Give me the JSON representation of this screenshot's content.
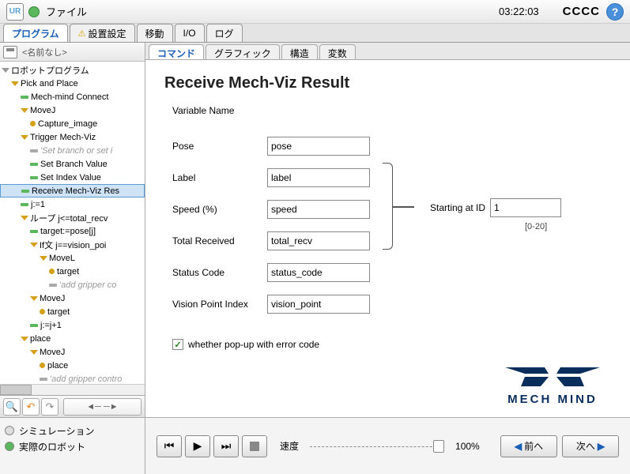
{
  "titlebar": {
    "file": "ファイル",
    "time": "03:22:03",
    "cccc": "CCCC"
  },
  "main_tabs": [
    "プログラム",
    "設置設定",
    "移動",
    "I/O",
    "ログ"
  ],
  "filebar": {
    "name": "<名前なし>"
  },
  "tree": {
    "root": "ロボットプログラム",
    "items": [
      "Pick and Place",
      "Mech-mind Connect",
      "MoveJ",
      "Capture_image",
      "Trigger Mech-Viz",
      "'Set branch or set i",
      "Set Branch Value",
      "Set Index Value",
      "Receive Mech-Viz Res",
      "j:=1",
      "ループ j<=total_recv",
      "target:=pose[j]",
      "If文 j==vision_poi",
      "MoveL",
      "target",
      "'add gripper co",
      "MoveJ",
      "target",
      "j:=j+1",
      "place",
      "MoveJ",
      "place",
      "'add gripper contro"
    ]
  },
  "sub_tabs": [
    "コマンド",
    "グラフィック",
    "構造",
    "変数"
  ],
  "panel": {
    "title": "Receive Mech-Viz Result",
    "var_title": "Variable Name",
    "labels": {
      "pose": "Pose",
      "label": "Label",
      "speed": "Speed (%)",
      "total": "Total Received",
      "status": "Status Code",
      "vpi": "Vision Point Index"
    },
    "values": {
      "pose": "pose",
      "label": "label",
      "speed": "speed",
      "total": "total_recv",
      "status": "status_code",
      "vpi": "vision_point"
    },
    "starting_label": "Starting at ID",
    "starting_value": "1",
    "range": "[0-20]",
    "checkbox": "whether pop-up with error code",
    "logo_text": "MECH MIND"
  },
  "bottom": {
    "sim": "シミュレーション",
    "real": "実際のロボット",
    "speed_label": "速度",
    "speed_value": "100%",
    "prev": "前へ",
    "next": "次へ"
  }
}
